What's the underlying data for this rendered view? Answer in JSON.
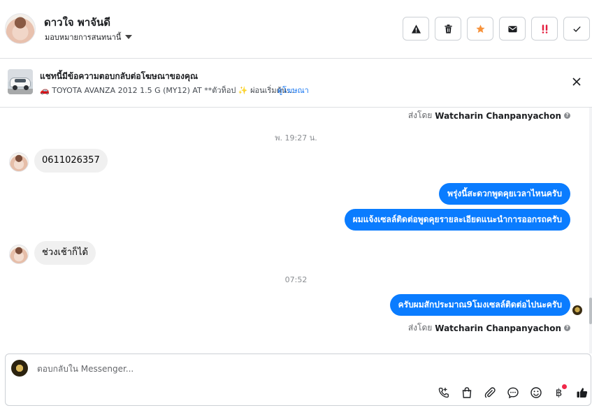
{
  "header": {
    "contact_name": "ดาวใจ พาจันดี",
    "assign_label": "มอบหมายการสนทนานี้",
    "actions": [
      {
        "icon": "warning-icon"
      },
      {
        "icon": "trash-icon"
      },
      {
        "icon": "star-icon"
      },
      {
        "icon": "mail-icon"
      },
      {
        "icon": "spam-icon"
      },
      {
        "icon": "check-icon"
      }
    ]
  },
  "ad": {
    "title": "แชทนี้มีข้อความตอบกลับต่อโฆษณาของคุณ",
    "subtitle": "🚗 TOYOTA AVANZA 2012 1.5 G (MY12) AT **ตัวท็อป ✨ ผ่อนเริ่มต้น...",
    "link": "ดูโฆษณา"
  },
  "conversation": {
    "sent_by_prefix": "ส่งโดย",
    "sender": "Watcharin Chanpanyachon",
    "timestamp_1": "พ. 19:27 น.",
    "timestamp_2": "07:52",
    "messages": [
      {
        "direction": "in",
        "text": "0611026357"
      },
      {
        "direction": "out",
        "text": "พรุ่งนี้สะดวกพูดคุยเวลาไหนครับ"
      },
      {
        "direction": "out",
        "text": "ผมแจ้งเซลล์ติดต่อพูดคุยรายละเอียดแนะนำการออกรถครับ"
      },
      {
        "direction": "in",
        "text": "ช่วงเช้าก็ได้"
      },
      {
        "direction": "out",
        "text": "ครับผมสักประมาณ9โมงเซลล์ติดต่อไปนะครับ"
      }
    ]
  },
  "composer": {
    "placeholder": "ตอบกลับใน Messenger...",
    "tools": [
      "call-icon",
      "shopping-bag-icon",
      "attachment-icon",
      "chat-bubble-icon",
      "emoji-icon",
      "baht-icon",
      "like-icon"
    ],
    "baht_symbol": "฿"
  },
  "colors": {
    "accent": "#0a7cff",
    "link": "#1877f2",
    "star": "#f7923b",
    "spam": "#e41e3f"
  }
}
